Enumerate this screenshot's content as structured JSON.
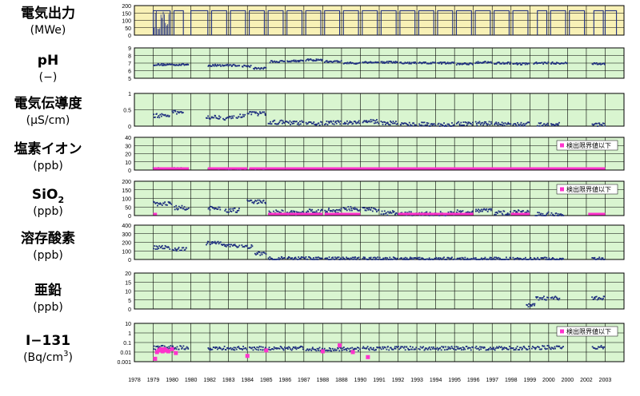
{
  "x_axis": {
    "ticks": [
      "1978",
      "1979",
      "1980",
      "1980",
      "1982",
      "1983",
      "1984",
      "1985",
      "1986",
      "1987",
      "1988",
      "1888",
      "1990",
      "1991",
      "1992",
      "1993",
      "1994",
      "1995",
      "1996",
      "1997",
      "1998",
      "1999",
      "2000",
      "2000",
      "2002",
      "2003"
    ]
  },
  "legend_text": "検出限界値以下",
  "colors": {
    "series": "#1f2f7f",
    "below_limit": "#ff33cc",
    "grid_bg": "#d9f5d0",
    "power_bg": "#f8f1b6",
    "grid_line": "#000000"
  },
  "chart_data": [
    {
      "type": "area",
      "label_lines": [
        "電気出力",
        "(MWe)"
      ],
      "yticks": [
        "200",
        "150",
        "100",
        "50",
        "0"
      ],
      "ylim": [
        0,
        200
      ],
      "legend": false,
      "operating_periods": [
        [
          1979.0,
          1979.9
        ],
        [
          1980.1,
          1980.6
        ],
        [
          1981.0,
          1981.9
        ],
        [
          1982.1,
          1982.9
        ],
        [
          1983.1,
          1983.9
        ],
        [
          1984.1,
          1984.9
        ],
        [
          1985.1,
          1985.9
        ],
        [
          1986.1,
          1986.9
        ],
        [
          1987.1,
          1987.9
        ],
        [
          1988.1,
          1988.9
        ],
        [
          1989.1,
          1989.9
        ],
        [
          1990.1,
          1990.9
        ],
        [
          1991.1,
          1991.9
        ],
        [
          1992.1,
          1992.9
        ],
        [
          1993.1,
          1993.9
        ],
        [
          1994.1,
          1994.9
        ],
        [
          1995.1,
          1995.9
        ],
        [
          1996.1,
          1996.9
        ],
        [
          1997.1,
          1997.9
        ],
        [
          1998.1,
          1998.9
        ],
        [
          1999.4,
          1999.9
        ],
        [
          2000.1,
          2000.9
        ],
        [
          2001.1,
          2001.9
        ],
        [
          2002.4,
          2002.9
        ],
        [
          2003.0,
          2003.6
        ]
      ],
      "power_level": 165
    },
    {
      "type": "scatter",
      "label_lines": [
        "pH",
        "(−)"
      ],
      "yticks": [
        "9",
        "8",
        "7",
        "6",
        "5"
      ],
      "ylim": [
        5,
        9
      ],
      "legend": false,
      "series": [
        {
          "segments": [
            [
              1979.0,
              1980.9,
              6.8
            ],
            [
              1981.9,
              1983.6,
              6.7
            ],
            [
              1983.7,
              1984.2,
              6.6
            ],
            [
              1984.3,
              1985.0,
              6.3
            ],
            [
              1985.2,
              1986.0,
              7.2
            ],
            [
              1986.1,
              1987.0,
              7.3
            ],
            [
              1987.1,
              1988.0,
              7.4
            ],
            [
              1988.1,
              1989.0,
              7.2
            ],
            [
              1989.1,
              1990.0,
              7.0
            ],
            [
              1990.1,
              1991.0,
              7.1
            ],
            [
              1991.1,
              1992.0,
              7.1
            ],
            [
              1992.1,
              1993.0,
              7.0
            ],
            [
              1993.1,
              1994.0,
              7.0
            ],
            [
              1994.1,
              1995.0,
              7.0
            ],
            [
              1995.1,
              1996.0,
              6.9
            ],
            [
              1996.1,
              1997.0,
              7.1
            ],
            [
              1997.1,
              1998.0,
              7.0
            ],
            [
              1998.1,
              1999.0,
              6.9
            ],
            [
              1999.2,
              2000.0,
              7.0
            ],
            [
              2000.1,
              2001.0,
              7.0
            ],
            [
              2002.3,
              2003.0,
              6.9
            ]
          ],
          "jitter": 0.25
        }
      ]
    },
    {
      "type": "scatter",
      "label_lines": [
        "電気伝導度",
        "(μS/cm)"
      ],
      "yticks": [
        "1",
        "0.5",
        "0"
      ],
      "ylim": [
        0,
        1
      ],
      "legend": false,
      "series": [
        {
          "segments": [
            [
              1979.0,
              1979.9,
              0.32
            ],
            [
              1980.0,
              1980.6,
              0.42
            ],
            [
              1981.8,
              1982.6,
              0.28
            ],
            [
              1982.7,
              1983.3,
              0.25
            ],
            [
              1983.4,
              1983.9,
              0.3
            ],
            [
              1984.0,
              1985.0,
              0.38
            ],
            [
              1985.1,
              1986.0,
              0.12
            ],
            [
              1986.0,
              1987.0,
              0.1
            ],
            [
              1987.1,
              1988.0,
              0.08
            ],
            [
              1988.1,
              1989.0,
              0.1
            ],
            [
              1989.1,
              1990.0,
              0.12
            ],
            [
              1990.1,
              1991.0,
              0.14
            ],
            [
              1991.1,
              1992.0,
              0.1
            ],
            [
              1992.1,
              1993.0,
              0.06
            ],
            [
              1993.1,
              1994.0,
              0.06
            ],
            [
              1994.1,
              1995.0,
              0.04
            ],
            [
              1995.1,
              1996.0,
              0.07
            ],
            [
              1996.1,
              1997.0,
              0.08
            ],
            [
              1997.1,
              1998.0,
              0.07
            ],
            [
              1998.1,
              1999.0,
              0.06
            ],
            [
              1999.4,
              2000.0,
              0.06
            ],
            [
              2000.1,
              2000.6,
              0.06
            ],
            [
              2002.3,
              2003.0,
              0.05
            ]
          ],
          "jitter": 0.12
        }
      ]
    },
    {
      "type": "scatter",
      "label_lines": [
        "塩素イオン",
        "(ppb)"
      ],
      "yticks": [
        "40",
        "30",
        "20",
        "10",
        "0"
      ],
      "ylim": [
        0,
        40
      ],
      "legend": true,
      "series": [
        {
          "segments": [
            [
              1979.0,
              1980.5,
              2
            ],
            [
              1981.9,
              1983.9,
              1.5
            ],
            [
              1984.1,
              1985.0,
              1.5
            ]
          ],
          "jitter": 1.5
        },
        {
          "below_limit": [
            [
              1979.0,
              1980.9
            ],
            [
              1981.9,
              1984.0
            ],
            [
              1984.1,
              1986.0
            ],
            [
              1986.0,
              2003.0
            ]
          ]
        }
      ]
    },
    {
      "type": "scatter",
      "label_lines": [
        "SiO",
        "(ppb)"
      ],
      "label_sub": "2",
      "yticks": [
        "200",
        "150",
        "100",
        "50",
        "0"
      ],
      "ylim": [
        0,
        200
      ],
      "legend": true,
      "series": [
        {
          "segments": [
            [
              1979.0,
              1980.0,
              70
            ],
            [
              1980.1,
              1980.9,
              45
            ],
            [
              1981.9,
              1982.6,
              40
            ],
            [
              1982.8,
              1983.6,
              30
            ],
            [
              1984.0,
              1985.0,
              80
            ],
            [
              1985.1,
              1986.0,
              20
            ],
            [
              1986.1,
              1987.0,
              15
            ],
            [
              1987.1,
              1988.0,
              25
            ],
            [
              1988.1,
              1989.0,
              30
            ],
            [
              1989.1,
              1990.0,
              40
            ],
            [
              1990.1,
              1991.0,
              35
            ],
            [
              1991.1,
              1992.0,
              15
            ],
            [
              1992.1,
              1993.0,
              10
            ],
            [
              1993.1,
              1994.0,
              10
            ],
            [
              1994.1,
              1995.0,
              10
            ],
            [
              1995.1,
              1996.0,
              20
            ],
            [
              1996.1,
              1997.0,
              30
            ],
            [
              1997.1,
              1998.0,
              15
            ],
            [
              1998.1,
              1999.0,
              20
            ],
            [
              1999.3,
              2000.0,
              8
            ],
            [
              2000.1,
              2000.8,
              5
            ]
          ],
          "jitter": 25
        },
        {
          "below_limit": [
            [
              1979.0,
              1979.2
            ],
            [
              1985.1,
              1988.0
            ],
            [
              1988.1,
              1990.0
            ],
            [
              1992.0,
              1996.0
            ],
            [
              1998.0,
              1999.0
            ],
            [
              2002.1,
              2003.0
            ]
          ]
        }
      ]
    },
    {
      "type": "scatter",
      "label_lines": [
        "溶存酸素",
        "(ppb)"
      ],
      "yticks": [
        "400",
        "300",
        "200",
        "100",
        "0"
      ],
      "ylim": [
        0,
        400
      ],
      "legend": false,
      "series": [
        {
          "segments": [
            [
              1979.0,
              1979.9,
              140
            ],
            [
              1980.0,
              1980.8,
              120
            ],
            [
              1981.8,
              1982.6,
              190
            ],
            [
              1982.6,
              1983.6,
              160
            ],
            [
              1983.7,
              1984.3,
              150
            ],
            [
              1984.4,
              1985.0,
              70
            ],
            [
              1985.1,
              1986.0,
              15
            ],
            [
              1986.1,
              1988.0,
              10
            ],
            [
              1988.1,
              1990.0,
              8
            ],
            [
              1990.1,
              1992.0,
              8
            ],
            [
              1992.1,
              1995.0,
              5
            ],
            [
              1995.1,
              1998.0,
              5
            ],
            [
              1998.1,
              2000.8,
              5
            ],
            [
              2002.3,
              2003.0,
              5
            ]
          ],
          "jitter": 40
        }
      ]
    },
    {
      "type": "scatter",
      "label_lines": [
        "亜鉛",
        "(ppb)"
      ],
      "yticks": [
        "20",
        "15",
        "10",
        "5",
        "0"
      ],
      "ylim": [
        0,
        20
      ],
      "legend": false,
      "series": [
        {
          "segments": [
            [
              1998.8,
              1999.3,
              2
            ],
            [
              1999.3,
              2000.0,
              6
            ],
            [
              2000.1,
              2000.6,
              6
            ],
            [
              2002.3,
              2003.0,
              6
            ]
          ],
          "jitter": 2
        }
      ]
    },
    {
      "type": "scatter",
      "label_lines": [
        "I−131",
        "(Bq/cm"
      ],
      "label_sup": "3",
      "label_tail": ")",
      "yticks": [
        "10",
        "1",
        "0.1",
        "0.01",
        "0.001"
      ],
      "ylim": [
        0.001,
        10
      ],
      "log": true,
      "legend": true,
      "series": [
        {
          "segments": [
            [
              1979.0,
              1980.9,
              0.03
            ],
            [
              1981.9,
              1984.0,
              0.025
            ],
            [
              1984.1,
              1987.0,
              0.025
            ],
            [
              1987.1,
              1990.0,
              0.02
            ],
            [
              1990.1,
              1993.0,
              0.025
            ],
            [
              1993.1,
              1996.0,
              0.025
            ],
            [
              1996.1,
              1999.0,
              0.025
            ],
            [
              1999.1,
              2000.8,
              0.03
            ],
            [
              2002.3,
              2003.0,
              0.03
            ]
          ],
          "jitter": 0.4
        },
        {
          "below_limit_points": [
            [
              1979.1,
              0.002
            ],
            [
              1979.2,
              0.01
            ],
            [
              1979.3,
              0.015
            ],
            [
              1979.4,
              0.02
            ],
            [
              1979.5,
              0.012
            ],
            [
              1979.6,
              0.02
            ],
            [
              1979.7,
              0.015
            ],
            [
              1979.8,
              0.012
            ],
            [
              1980.0,
              0.02
            ],
            [
              1980.2,
              0.008
            ],
            [
              1984.0,
              0.004
            ],
            [
              1985.0,
              0.015
            ],
            [
              1988.0,
              0.012
            ],
            [
              1988.9,
              0.05
            ],
            [
              1989.6,
              0.01
            ],
            [
              1990.4,
              0.003
            ]
          ]
        }
      ]
    }
  ]
}
